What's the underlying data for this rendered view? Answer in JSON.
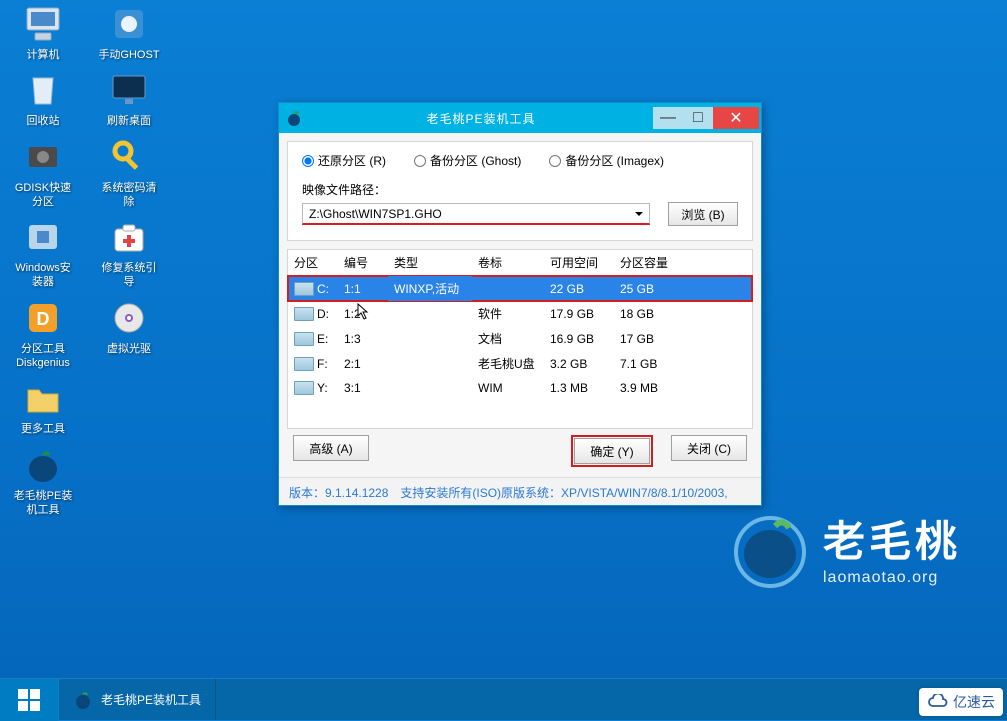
{
  "desktop_icons": {
    "r0c0": "计算机",
    "r0c1": "手动GHOST",
    "r1c0": "回收站",
    "r1c1": "刷新桌面",
    "r2c0": "GDISK快速分区",
    "r2c1": "系统密码清除",
    "r3c0": "Windows安装器",
    "r3c1": "修复系统引导",
    "r4c0": "分区工具Diskgenius",
    "r4c1": "虚拟光驱",
    "r5c0": "更多工具",
    "r6c0": "老毛桃PE装机工具"
  },
  "window": {
    "title": "老毛桃PE装机工具",
    "radios": {
      "restore": "还原分区 (R)",
      "backup_ghost": "备份分区 (Ghost)",
      "backup_imagex": "备份分区 (Imagex)"
    },
    "path_label": "映像文件路径：",
    "path_value": "Z:\\Ghost\\WIN7SP1.GHO",
    "browse": "浏览 (B)",
    "columns": {
      "part": "分区",
      "num": "编号",
      "type": "类型",
      "vol": "卷标",
      "avail": "可用空间",
      "cap": "分区容量"
    },
    "rows": [
      {
        "drive": "C:",
        "num": "1:1",
        "type": "WINXP,活动",
        "vol": "",
        "avail": "22 GB",
        "cap": "25 GB"
      },
      {
        "drive": "D:",
        "num": "1:2",
        "type": "",
        "vol": "软件",
        "avail": "17.9 GB",
        "cap": "18 GB"
      },
      {
        "drive": "E:",
        "num": "1:3",
        "type": "",
        "vol": "文档",
        "avail": "16.9 GB",
        "cap": "17 GB"
      },
      {
        "drive": "F:",
        "num": "2:1",
        "type": "",
        "vol": "老毛桃U盘",
        "avail": "3.2 GB",
        "cap": "7.1 GB"
      },
      {
        "drive": "Y:",
        "num": "3:1",
        "type": "",
        "vol": "WIM",
        "avail": "1.3 MB",
        "cap": "3.9 MB"
      }
    ],
    "buttons": {
      "advanced": "高级 (A)",
      "ok": "确定 (Y)",
      "close": "关闭 (C)"
    },
    "status": "版本：9.1.14.1228 支持安装所有(ISO)原版系统：XP/VISTA/WIN7/8/8.1/10/2003,"
  },
  "taskbar": {
    "task1": "老毛桃PE装机工具"
  },
  "brand": {
    "name": "老毛桃",
    "url": "laomaotao.org"
  },
  "watermark": "亿速云"
}
